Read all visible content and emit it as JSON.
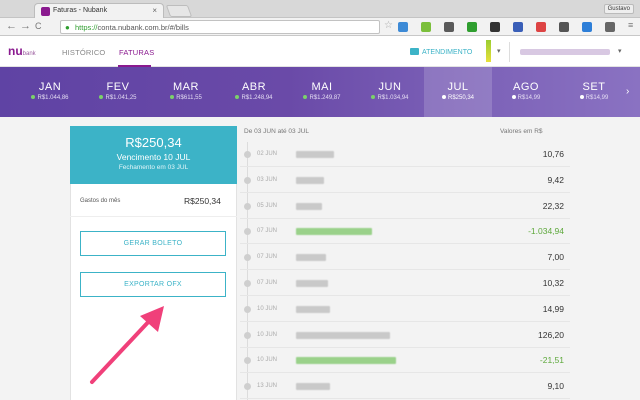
{
  "browser": {
    "tab_title": "Faturas - Nubank",
    "tab_close": "×",
    "user_label": "Gustavo",
    "url_scheme": "https://",
    "url_rest": "conta.nubank.com.br/#/bills",
    "nav_back": "←",
    "nav_forward": "→",
    "nav_reload": "C",
    "star": "☆",
    "ext_colors": [
      "#3d8ad6",
      "#7bbf3b",
      "#5a5a5a",
      "#2f9e2f",
      "#333333",
      "#3a5fb8",
      "#d44",
      "#555555",
      "#2e7fd8",
      "#666666"
    ]
  },
  "header": {
    "logo_main": "nu",
    "logo_small": "bank",
    "tabs": [
      {
        "label": "HISTÓRICO",
        "active": false
      },
      {
        "label": "FATURAS",
        "active": true
      }
    ],
    "atendimento": "ATENDIMENTO",
    "chevron": "▾",
    "account_chevron": "▾"
  },
  "months": {
    "items": [
      {
        "name": "JAN",
        "value": "R$1.044,86",
        "dot": "#7bd26a",
        "selected": false
      },
      {
        "name": "FEV",
        "value": "R$1.041,25",
        "dot": "#7bd26a",
        "selected": false
      },
      {
        "name": "MAR",
        "value": "R$611,55",
        "dot": "#7bd26a",
        "selected": false
      },
      {
        "name": "ABR",
        "value": "R$1.248,94",
        "dot": "#7bd26a",
        "selected": false
      },
      {
        "name": "MAI",
        "value": "R$1.249,87",
        "dot": "#7bd26a",
        "selected": false
      },
      {
        "name": "JUN",
        "value": "R$1.034,94",
        "dot": "#7bd26a",
        "selected": false
      },
      {
        "name": "JUL",
        "value": "R$250,34",
        "dot": "#ffffff",
        "selected": true
      },
      {
        "name": "AGO",
        "value": "R$14,99",
        "dot": "#ffffff",
        "selected": false
      },
      {
        "name": "SET",
        "value": "R$14,99",
        "dot": "#ffffff",
        "selected": false
      }
    ],
    "next": "›"
  },
  "bill": {
    "amount": "R$250,34",
    "due": "Vencimento 10 JUL",
    "closing": "Fechamento em 03 JUL",
    "gastos_label": "Gastos do mês",
    "gastos_value": "R$250,34",
    "gerar_boleto": "GERAR BOLETO",
    "exportar_ofx": "EXPORTAR OFX"
  },
  "transactions": {
    "period": "De 03 JUN até 03 JUL",
    "values_label": "Valores em R$",
    "rows": [
      {
        "date": "02 JUN",
        "amount": "10,76",
        "credit": false
      },
      {
        "date": "03 JUN",
        "amount": "9,42",
        "credit": false
      },
      {
        "date": "05 JUN",
        "amount": "22,32",
        "credit": false
      },
      {
        "date": "07 JUN",
        "amount": "-1.034,94",
        "credit": true
      },
      {
        "date": "07 JUN",
        "amount": "7,00",
        "credit": false
      },
      {
        "date": "07 JUN",
        "amount": "10,32",
        "credit": false
      },
      {
        "date": "10 JUN",
        "amount": "14,99",
        "credit": false
      },
      {
        "date": "10 JUN",
        "amount": "126,20",
        "credit": false
      },
      {
        "date": "10 JUN",
        "amount": "-21,51",
        "credit": true
      },
      {
        "date": "13 JUN",
        "amount": "9,10",
        "credit": false
      }
    ]
  }
}
